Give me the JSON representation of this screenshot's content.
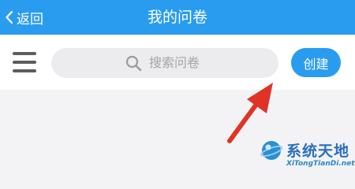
{
  "header": {
    "back_label": "返回",
    "title": "我的问卷"
  },
  "toolbar": {
    "menu_icon": "hamburger-menu-icon",
    "search_placeholder": "搜索问卷",
    "search_icon": "search-icon",
    "create_label": "创建"
  },
  "watermark": {
    "name_cn": "系统天地",
    "name_en": "XiTongTianDi.net"
  },
  "colors": {
    "accent": "#2a9cf0",
    "annotation_arrow": "#e03326",
    "background": "#f3f3f5"
  }
}
